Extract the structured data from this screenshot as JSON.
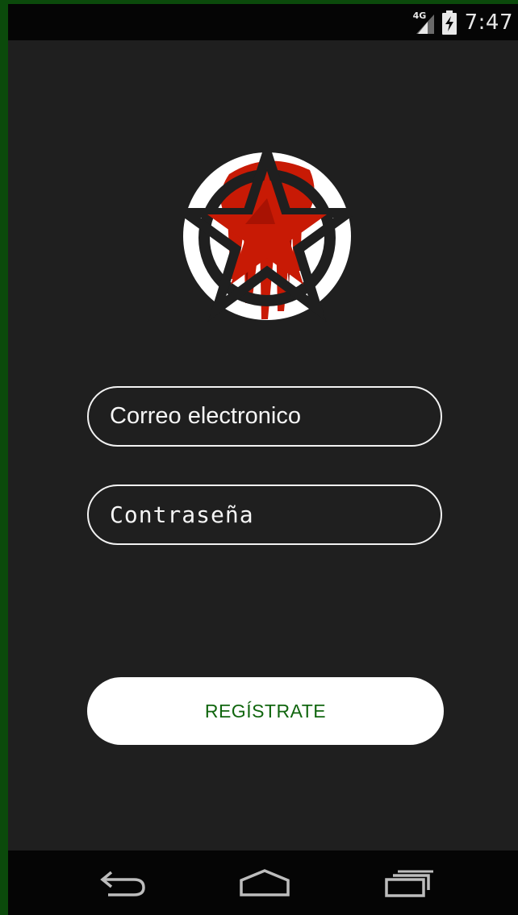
{
  "status_bar": {
    "network": "4G",
    "time": "7:47",
    "icons": [
      "signal-icon",
      "battery-charging-icon"
    ]
  },
  "logo": {
    "icon": "bloody-star-emblem",
    "colors": {
      "ring": "#ffffff",
      "star": "#1f1f1f",
      "blood": "#c81a05"
    }
  },
  "form": {
    "email_placeholder": "Correo electronico",
    "password_placeholder": "Contraseña"
  },
  "actions": {
    "register_label": "REGÍSTRATE"
  },
  "nav_bar": {
    "icons": [
      "back-icon",
      "home-icon",
      "recent-apps-icon"
    ]
  },
  "colors": {
    "background": "#1f1f1f",
    "frame": "#0b4a0b",
    "accent": "#11660f",
    "field_border": "#f2f2f2"
  }
}
